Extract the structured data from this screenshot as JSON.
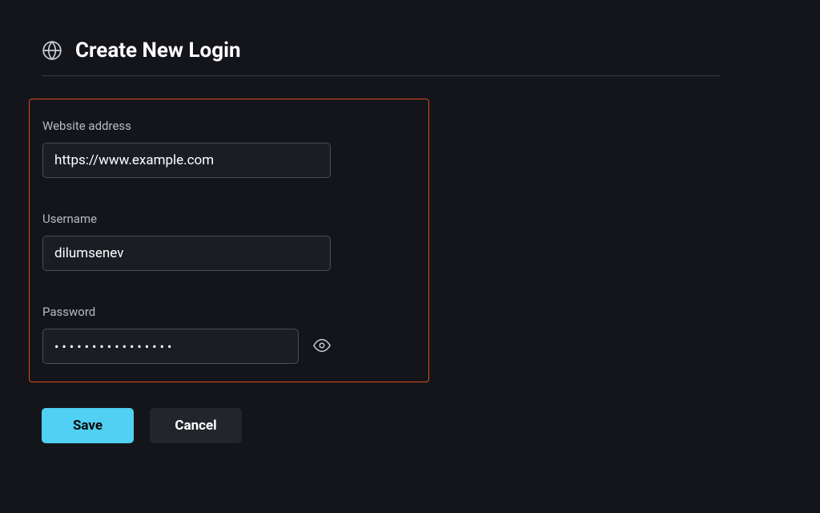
{
  "page": {
    "title": "Create New Login"
  },
  "fields": {
    "website": {
      "label": "Website address",
      "value": "https://www.example.com"
    },
    "username": {
      "label": "Username",
      "value": "dilumsenev"
    },
    "password": {
      "label": "Password",
      "masked": "••••••••••••••••"
    }
  },
  "buttons": {
    "save": "Save",
    "cancel": "Cancel"
  }
}
